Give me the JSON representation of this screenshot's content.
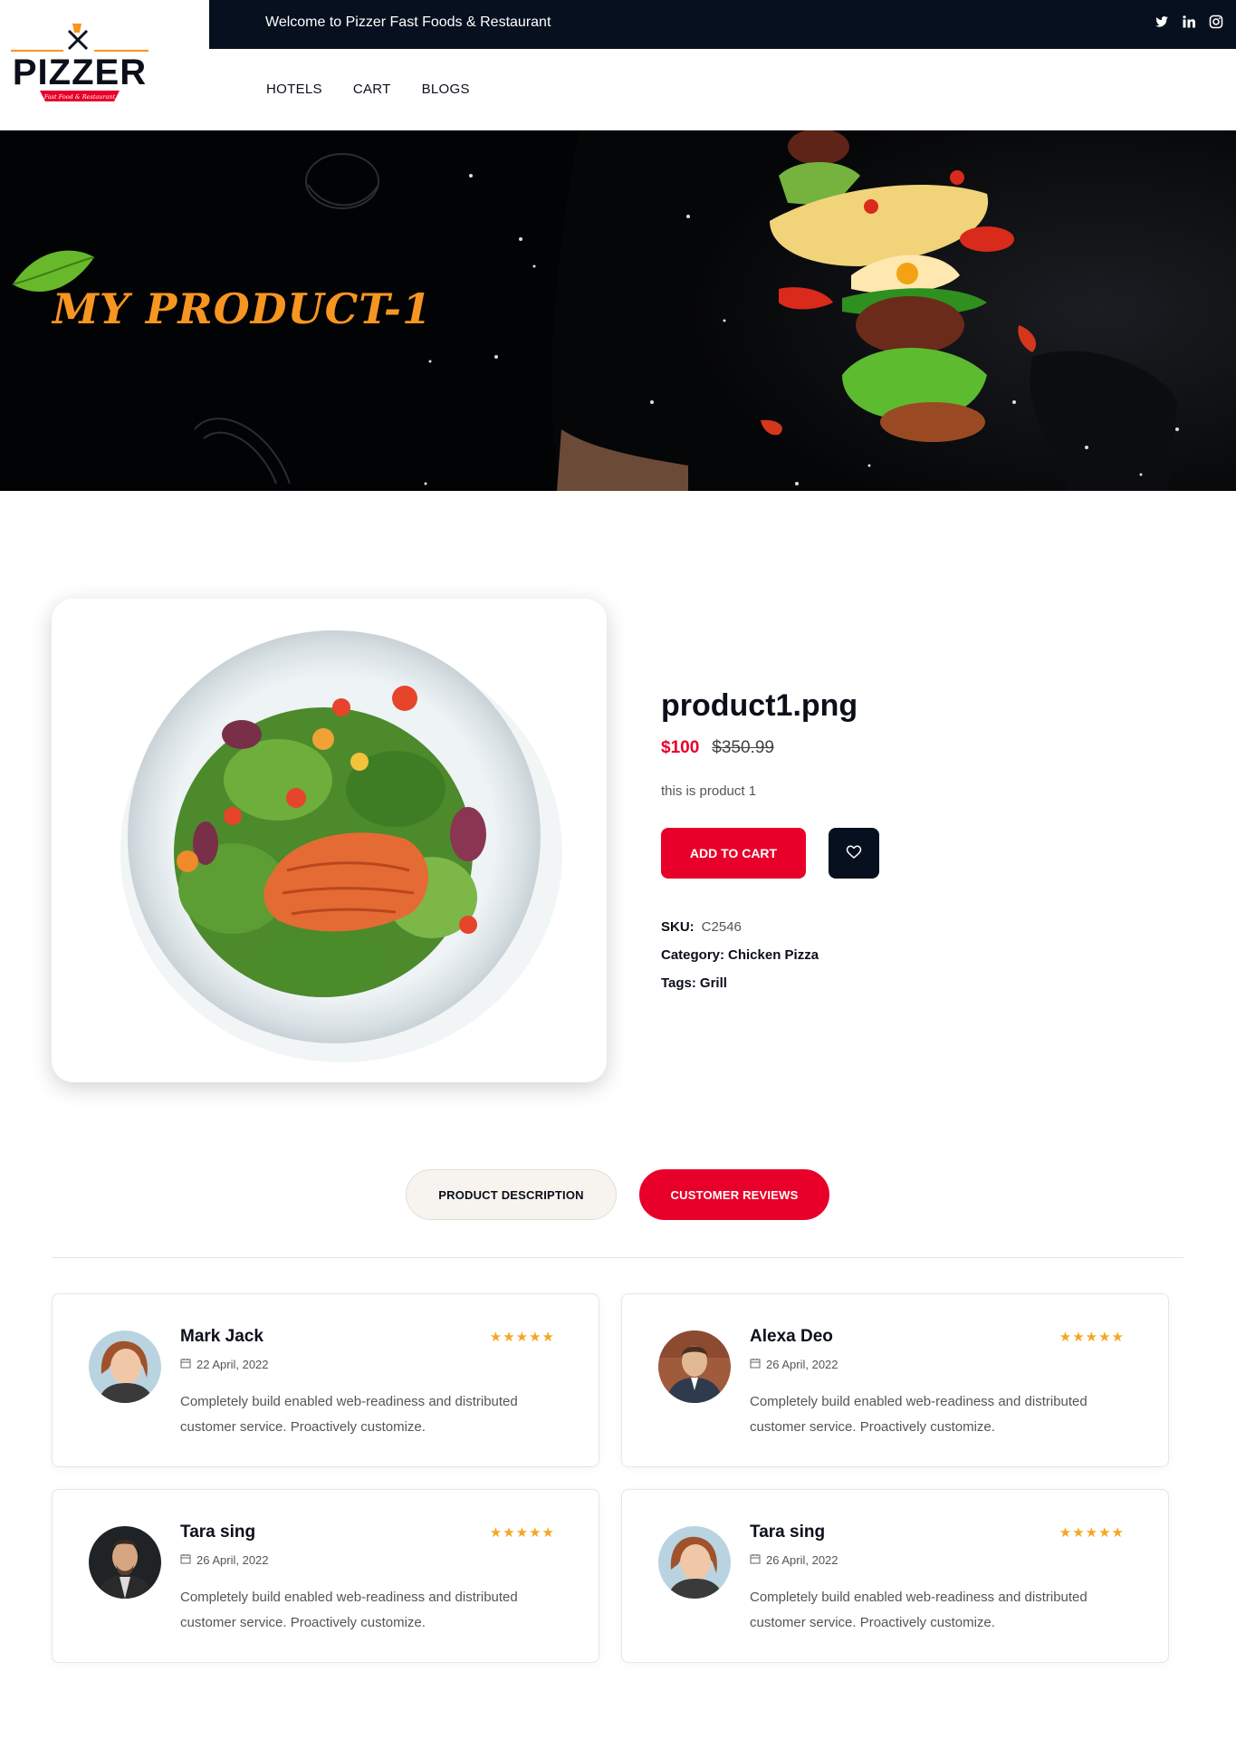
{
  "brand": {
    "name": "PIZZER",
    "tagline": "Fast Food & Restaurant",
    "accent": "#f79521",
    "red": "#e8002a",
    "navy": "#07101f"
  },
  "topbar": {
    "welcome": "Welcome to Pizzer Fast Foods & Restaurant",
    "social_icons": [
      "twitter-icon",
      "linkedin-icon",
      "instagram-icon"
    ]
  },
  "nav": {
    "items": [
      "HOTELS",
      "CART",
      "BLOGS"
    ]
  },
  "hero": {
    "title": "MY PRODUCT-1"
  },
  "product": {
    "name": "product1.png",
    "price": "$100",
    "old_price": "$350.99",
    "description": "this is product 1",
    "add_to_cart_label": "ADD TO CART",
    "sku_label": "SKU:",
    "sku_value": "C2546",
    "category_label": "Category:",
    "category_value": "Chicken Pizza",
    "tags_label": "Tags:",
    "tags_value": "Grill"
  },
  "tabs": {
    "description": "PRODUCT DESCRIPTION",
    "reviews": "CUSTOMER REVIEWS",
    "active": "reviews"
  },
  "reviews": [
    {
      "name": "Mark Jack",
      "date": "22 April, 2022",
      "stars": "★★★★★",
      "rating": 5,
      "text": "Completely build enabled web-readiness and distributed customer service. Proactively customize."
    },
    {
      "name": "Alexa Deo",
      "date": "26 April, 2022",
      "stars": "★★★★★",
      "rating": 5,
      "text": "Completely build enabled web-readiness and distributed customer service. Proactively customize."
    },
    {
      "name": "Tara sing",
      "date": "26 April, 2022",
      "stars": "★★★★★",
      "rating": 5,
      "text": "Completely build enabled web-readiness and distributed customer service. Proactively customize."
    },
    {
      "name": "Tara sing",
      "date": "26 April, 2022",
      "stars": "★★★★★",
      "rating": 5,
      "text": "Completely build enabled web-readiness and distributed customer service. Proactively customize."
    }
  ]
}
